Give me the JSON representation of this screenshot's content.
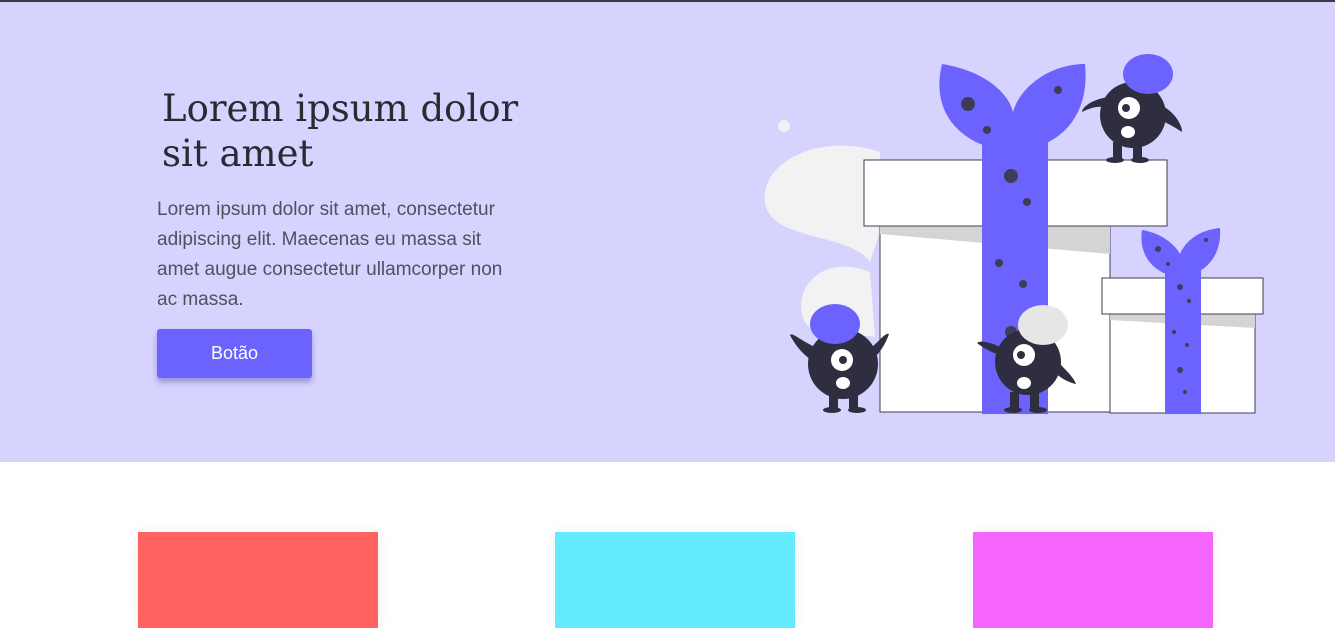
{
  "hero": {
    "title": "Lorem ipsum dolor sit amet",
    "text": "Lorem ipsum dolor sit amet, consectetur adipiscing elit. Maecenas eu massa sit amet augue consectetur ullamcorper non ac massa.",
    "button_label": "Botão",
    "background": "#d6d3ff",
    "accent": "#6c63ff",
    "illustration": "gifts-and-monsters-illustration"
  },
  "cards": [
    {
      "name": "card-red",
      "color": "#ff6361"
    },
    {
      "name": "card-cyan",
      "color": "#62ebfc"
    },
    {
      "name": "card-magenta",
      "color": "#f564fc"
    }
  ]
}
